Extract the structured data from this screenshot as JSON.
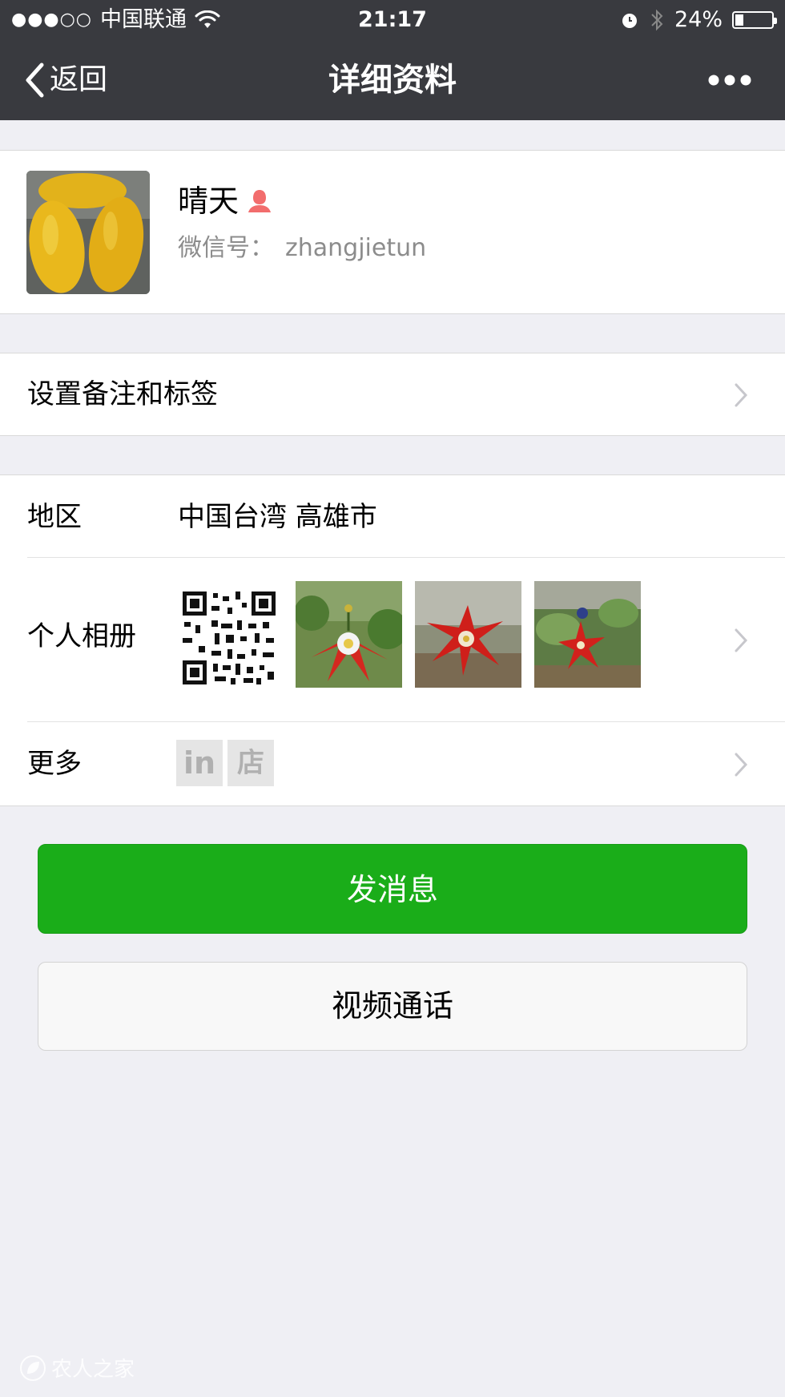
{
  "status_bar": {
    "signal": "●●●○○",
    "carrier": "中国联通",
    "time": "21:17",
    "battery": "24%"
  },
  "nav": {
    "back_label": "返回",
    "title": "详细资料"
  },
  "profile": {
    "name": "晴天",
    "wechat_id_label": "微信号：",
    "wechat_id": "zhangjietun"
  },
  "remark_row": {
    "label": "设置备注和标签"
  },
  "region_row": {
    "label": "地区",
    "value": "中国台湾 高雄市"
  },
  "album_row": {
    "label": "个人相册"
  },
  "more_row": {
    "label": "更多",
    "icons": [
      "in",
      "店"
    ]
  },
  "buttons": {
    "message": "发消息",
    "video_call": "视频通话"
  },
  "watermark": "农人之家",
  "colors": {
    "nav_bg": "#393a3f",
    "page_bg": "#efeff4",
    "primary_green": "#1aad19",
    "gender_icon": "#f26d6d"
  }
}
